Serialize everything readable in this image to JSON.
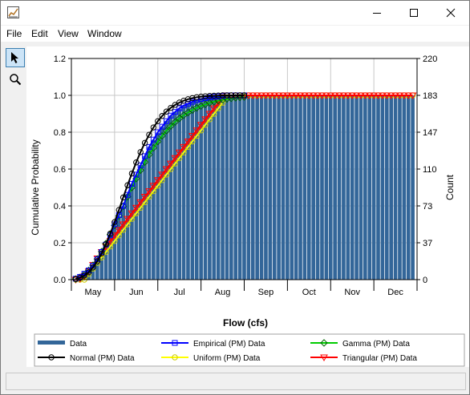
{
  "window": {
    "title": "",
    "menus": [
      "File",
      "Edit",
      "View",
      "Window"
    ]
  },
  "toolbar": {
    "tools": [
      {
        "name": "pointer-tool",
        "icon": "arrow-cursor-icon",
        "active": true
      },
      {
        "name": "zoom-tool",
        "icon": "magnifier-icon",
        "active": false
      }
    ]
  },
  "chart_data": {
    "type": "bar",
    "title": "",
    "xlabel": "Flow (cfs)",
    "ylabel": "Cumulative Probability",
    "y2label": "Count",
    "xlim": [
      0,
      80
    ],
    "ylim": [
      0,
      1.2
    ],
    "y2lim": [
      0,
      220
    ],
    "yticks": [
      "0.0",
      "0.2",
      "0.4",
      "0.6",
      "0.8",
      "1.0",
      "1.2"
    ],
    "y2ticks": [
      "0",
      "37",
      "73",
      "110",
      "147",
      "183",
      "220"
    ],
    "x_categories": [
      "May",
      "Jun",
      "Jul",
      "Aug",
      "Sep",
      "Oct",
      "Nov",
      "Dec"
    ],
    "grid": true,
    "legend_position": "bottom",
    "bar_color": "#336699",
    "bars": {
      "name": "Data",
      "x": [
        1,
        2,
        3,
        4,
        5,
        6,
        7,
        8,
        9,
        10,
        11,
        12,
        13,
        14,
        15,
        16,
        17,
        18,
        19,
        20,
        21,
        22,
        23,
        24,
        25,
        26,
        27,
        28,
        29,
        30,
        31,
        32,
        33,
        34,
        35,
        36,
        37,
        38,
        39,
        40,
        41,
        42,
        43,
        44,
        45,
        46,
        47,
        48,
        49,
        50,
        51,
        52,
        53,
        54,
        55,
        56,
        57,
        58,
        59,
        60,
        61,
        62,
        63,
        64,
        65,
        66,
        67,
        68,
        69,
        70,
        71,
        72,
        73,
        74,
        75,
        76,
        77,
        78,
        79
      ],
      "counts": [
        1,
        3,
        6,
        9,
        14,
        20,
        27,
        35,
        44,
        54,
        63,
        73,
        84,
        94,
        104,
        114,
        123,
        132,
        139,
        146,
        152,
        158,
        163,
        167,
        170,
        173,
        175,
        177,
        179,
        180,
        181,
        181,
        182,
        182,
        182,
        183,
        183,
        183,
        183,
        183,
        183,
        183,
        183,
        183,
        183,
        183,
        183,
        183,
        183,
        183,
        183,
        183,
        183,
        183,
        183,
        183,
        183,
        183,
        183,
        183,
        183,
        183,
        183,
        183,
        183,
        183,
        183,
        183,
        183,
        183,
        183,
        183,
        183,
        183,
        183,
        183,
        183,
        183,
        183
      ]
    },
    "series": [
      {
        "name": "Empirical (PM) Data",
        "color": "#0000ff",
        "marker": "square",
        "x": [
          1,
          2,
          3,
          4,
          5,
          6,
          7,
          8,
          9,
          10,
          11,
          12,
          13,
          14,
          15,
          16,
          17,
          18,
          19,
          20,
          21,
          22,
          23,
          24,
          25,
          26,
          27,
          28,
          29,
          30,
          31,
          32,
          33,
          34,
          35,
          36,
          37,
          38,
          39,
          40
        ],
        "y": [
          0.005,
          0.015,
          0.032,
          0.05,
          0.075,
          0.11,
          0.15,
          0.19,
          0.24,
          0.3,
          0.35,
          0.4,
          0.46,
          0.52,
          0.57,
          0.62,
          0.67,
          0.72,
          0.76,
          0.8,
          0.83,
          0.86,
          0.89,
          0.91,
          0.93,
          0.945,
          0.955,
          0.965,
          0.975,
          0.98,
          0.985,
          0.99,
          0.993,
          0.995,
          0.997,
          0.999,
          1.0,
          1.0,
          1.0,
          1.0
        ]
      },
      {
        "name": "Gamma (PM) Data",
        "color": "#00cc00",
        "marker": "diamond",
        "x": [
          1,
          2,
          3,
          4,
          5,
          6,
          7,
          8,
          9,
          10,
          11,
          12,
          13,
          14,
          15,
          16,
          17,
          18,
          19,
          20,
          21,
          22,
          23,
          24,
          25,
          26,
          27,
          28,
          29,
          30,
          31,
          32,
          33,
          34,
          35,
          36,
          37,
          38,
          39,
          40
        ],
        "y": [
          0.003,
          0.012,
          0.028,
          0.05,
          0.078,
          0.112,
          0.152,
          0.196,
          0.244,
          0.294,
          0.346,
          0.398,
          0.45,
          0.5,
          0.548,
          0.594,
          0.638,
          0.678,
          0.715,
          0.749,
          0.78,
          0.808,
          0.833,
          0.855,
          0.875,
          0.892,
          0.907,
          0.92,
          0.932,
          0.942,
          0.951,
          0.959,
          0.965,
          0.971,
          0.976,
          0.98,
          0.984,
          0.987,
          0.989,
          0.991
        ]
      },
      {
        "name": "Normal (PM) Data",
        "color": "#000000",
        "marker": "circle",
        "x": [
          1,
          2,
          3,
          4,
          5,
          6,
          7,
          8,
          9,
          10,
          11,
          12,
          13,
          14,
          15,
          16,
          17,
          18,
          19,
          20,
          21,
          22,
          23,
          24,
          25,
          26,
          27,
          28,
          29,
          30,
          31,
          32,
          33,
          34,
          35,
          36,
          37,
          38,
          39,
          40
        ],
        "y": [
          0.004,
          0.01,
          0.022,
          0.04,
          0.066,
          0.1,
          0.142,
          0.192,
          0.25,
          0.312,
          0.378,
          0.446,
          0.512,
          0.576,
          0.636,
          0.692,
          0.742,
          0.786,
          0.826,
          0.86,
          0.888,
          0.912,
          0.932,
          0.948,
          0.961,
          0.971,
          0.979,
          0.985,
          0.99,
          0.993,
          0.995,
          0.997,
          0.998,
          0.999,
          1.0,
          1.0,
          1.0,
          1.0,
          1.0,
          1.0
        ]
      },
      {
        "name": "Uniform (PM) Data",
        "color": "#ffff00",
        "marker": "circle",
        "x": [
          1,
          2,
          3,
          4,
          5,
          6,
          7,
          8,
          9,
          10,
          11,
          12,
          13,
          14,
          15,
          16,
          17,
          18,
          19,
          20,
          21,
          22,
          23,
          24,
          25,
          26,
          27,
          28,
          29,
          30,
          31,
          32,
          33,
          34,
          35,
          36,
          37,
          38,
          39,
          40,
          41,
          42,
          43,
          44,
          45,
          46,
          47,
          48,
          49,
          50,
          51,
          52,
          53,
          54,
          55,
          56,
          57,
          58,
          59,
          60,
          61,
          62,
          63,
          64,
          65,
          66,
          67,
          68,
          69,
          70,
          71,
          72,
          73,
          74,
          75,
          76,
          77,
          78,
          79
        ],
        "y": [
          0.0,
          0.0,
          0.0,
          0.03,
          0.06,
          0.09,
          0.12,
          0.15,
          0.18,
          0.21,
          0.24,
          0.27,
          0.3,
          0.33,
          0.36,
          0.39,
          0.42,
          0.45,
          0.48,
          0.51,
          0.54,
          0.57,
          0.6,
          0.63,
          0.66,
          0.69,
          0.72,
          0.75,
          0.78,
          0.81,
          0.84,
          0.87,
          0.9,
          0.93,
          0.96,
          0.99,
          1.0,
          1.0,
          1.0,
          1.0,
          1.0,
          1.0,
          1.0,
          1.0,
          1.0,
          1.0,
          1.0,
          1.0,
          1.0,
          1.0,
          1.0,
          1.0,
          1.0,
          1.0,
          1.0,
          1.0,
          1.0,
          1.0,
          1.0,
          1.0,
          1.0,
          1.0,
          1.0,
          1.0,
          1.0,
          1.0,
          1.0,
          1.0,
          1.0,
          1.0,
          1.0,
          1.0,
          1.0,
          1.0,
          1.0,
          1.0,
          1.0,
          1.0,
          1.0
        ]
      },
      {
        "name": "Triangular (PM) Data",
        "color": "#ff0000",
        "marker": "triangle-down",
        "x": [
          1,
          2,
          3,
          4,
          5,
          6,
          7,
          8,
          9,
          10,
          11,
          12,
          13,
          14,
          15,
          16,
          17,
          18,
          19,
          20,
          21,
          22,
          23,
          24,
          25,
          26,
          27,
          28,
          29,
          30,
          31,
          32,
          33,
          34,
          35,
          36,
          37,
          38,
          39,
          40,
          41,
          42,
          43,
          44,
          45,
          46,
          47,
          48,
          49,
          50,
          51,
          52,
          53,
          54,
          55,
          56,
          57,
          58,
          59,
          60,
          61,
          62,
          63,
          64,
          65,
          66,
          67,
          68,
          69,
          70,
          71,
          72,
          73,
          74,
          75,
          76,
          77,
          78,
          79
        ],
        "y": [
          0.0,
          0.005,
          0.02,
          0.045,
          0.08,
          0.115,
          0.15,
          0.18,
          0.21,
          0.24,
          0.27,
          0.3,
          0.33,
          0.36,
          0.39,
          0.42,
          0.45,
          0.48,
          0.51,
          0.54,
          0.57,
          0.6,
          0.63,
          0.66,
          0.69,
          0.72,
          0.75,
          0.78,
          0.81,
          0.84,
          0.87,
          0.9,
          0.93,
          0.96,
          0.99,
          1.0,
          1.0,
          1.0,
          1.0,
          1.0,
          1.0,
          1.0,
          1.0,
          1.0,
          1.0,
          1.0,
          1.0,
          1.0,
          1.0,
          1.0,
          1.0,
          1.0,
          1.0,
          1.0,
          1.0,
          1.0,
          1.0,
          1.0,
          1.0,
          1.0,
          1.0,
          1.0,
          1.0,
          1.0,
          1.0,
          1.0,
          1.0,
          1.0,
          1.0,
          1.0,
          1.0,
          1.0,
          1.0,
          1.0,
          1.0,
          1.0,
          1.0,
          1.0,
          1.0
        ]
      }
    ],
    "legend": [
      {
        "label": "Data",
        "kind": "bar",
        "color": "#336699"
      },
      {
        "label": "Empirical (PM) Data",
        "kind": "line",
        "color": "#0000ff",
        "marker": "square"
      },
      {
        "label": "Gamma (PM) Data",
        "kind": "line",
        "color": "#00cc00",
        "marker": "diamond"
      },
      {
        "label": "Normal (PM) Data",
        "kind": "line",
        "color": "#000000",
        "marker": "circle"
      },
      {
        "label": "Uniform (PM) Data",
        "kind": "line",
        "color": "#ffff00",
        "marker": "circle"
      },
      {
        "label": "Triangular (PM) Data",
        "kind": "line",
        "color": "#ff0000",
        "marker": "triangle-down"
      }
    ]
  }
}
